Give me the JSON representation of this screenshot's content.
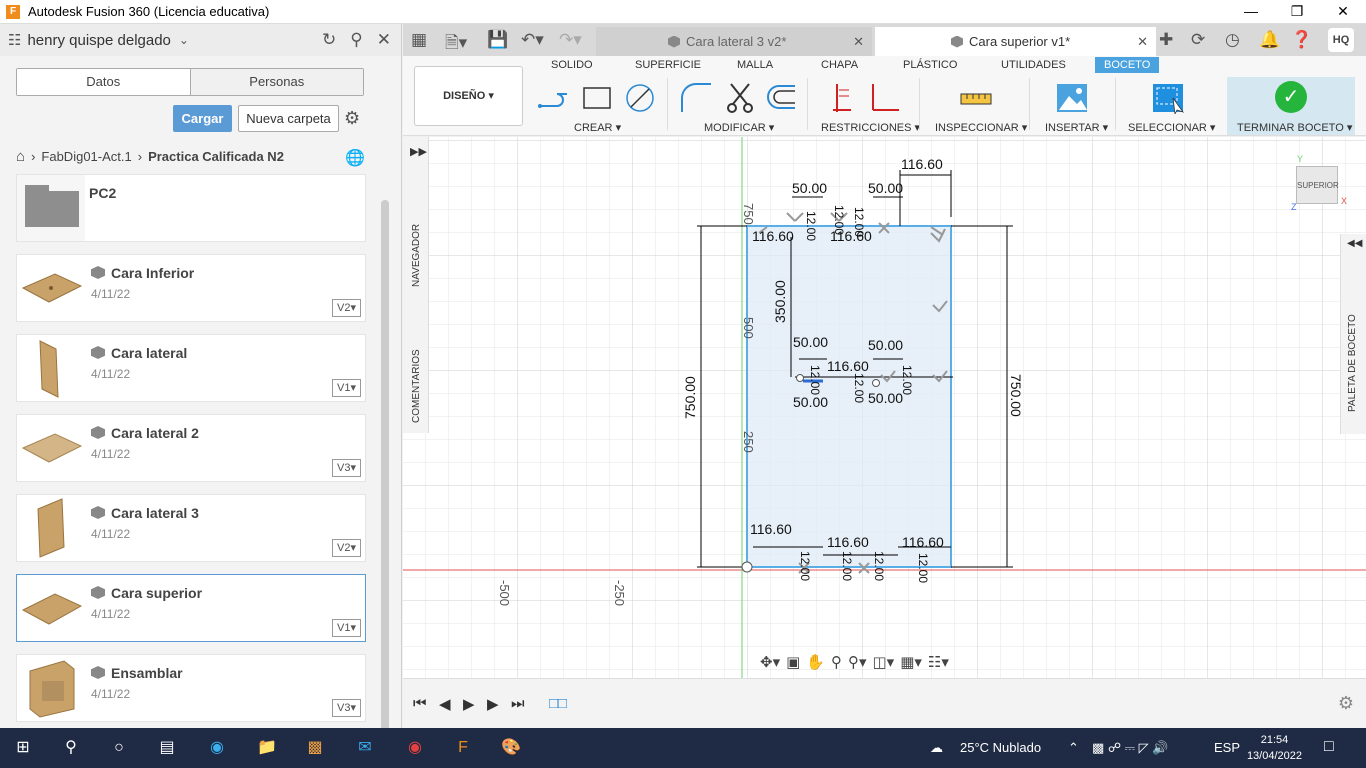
{
  "window": {
    "title": "Autodesk Fusion 360 (Licencia educativa)",
    "logo_letter": "F"
  },
  "data_panel": {
    "user": "henry quispe delgado",
    "tabs": [
      "Datos",
      "Personas"
    ],
    "upload_label": "Cargar",
    "new_folder_label": "Nueva carpeta",
    "breadcrumb": [
      "FabDig01-Act.1",
      "Practica Calificada N2"
    ],
    "folder": {
      "name": "PC2"
    },
    "files": [
      {
        "name": "Cara Inferior",
        "date": "4/11/22",
        "version": "V2"
      },
      {
        "name": "Cara lateral",
        "date": "4/11/22",
        "version": "V1"
      },
      {
        "name": "Cara lateral 2",
        "date": "4/11/22",
        "version": "V3"
      },
      {
        "name": "Cara lateral 3",
        "date": "4/11/22",
        "version": "V2"
      },
      {
        "name": "Cara superior",
        "date": "4/11/22",
        "version": "V1"
      },
      {
        "name": "Ensamblar",
        "date": "4/11/22",
        "version": "V3"
      }
    ]
  },
  "doc_tabs": [
    {
      "label": "Cara lateral 3 v2*"
    },
    {
      "label": "Cara superior v1*"
    }
  ],
  "profile_initials": "HQ",
  "toolbar": {
    "workspace": "DISEÑO",
    "menus": [
      "SOLIDO",
      "SUPERFICIE",
      "MALLA",
      "CHAPA",
      "PLÁSTICO",
      "UTILIDADES",
      "BOCETO"
    ],
    "groups": {
      "create": "CREAR",
      "modify": "MODIFICAR",
      "constraints": "RESTRICCIONES",
      "inspect": "INSPECCIONAR",
      "insert": "INSERTAR",
      "select": "SELECCIONAR",
      "finish": "TERMINAR BOCETO"
    }
  },
  "canvas": {
    "navigator_label": "NAVEGADOR",
    "comments_label": "COMENTARIOS",
    "palette_label": "PALETA DE BOCETO",
    "viewcube_label": "SUPERIOR",
    "axis_labels": {
      "y": "Y",
      "x": "X",
      "z": "Z"
    },
    "ruler_labels": [
      "-500",
      "-250",
      "750",
      "500",
      "250"
    ],
    "dimensions": {
      "top_right": "116.60",
      "top_a": "50.00",
      "top_b": "50.00",
      "top_c": "116.60",
      "top_d": "116.60",
      "top_v1": "12.00",
      "top_v2": "12.00",
      "top_v3": "12.00",
      "mid_v": "350.00",
      "mid_a": "50.00",
      "mid_b": "50.00",
      "mid_c": "116.60",
      "mid_d": "50.00",
      "mid_e": "50.00",
      "mid_v1": "12.00",
      "mid_v2": "12.00",
      "mid_v3": "12.00",
      "left_height": "750.00",
      "right_height": "750.00",
      "bot_a": "116.60",
      "bot_b": "116.60",
      "bot_c": "116.60",
      "bot_v1": "12.00",
      "bot_v2": "12.00",
      "bot_v3": "12.00",
      "bot_v4": "12.00"
    }
  },
  "taskbar": {
    "weather": "25°C  Nublado",
    "lang": "ESP",
    "time": "21:54",
    "date": "13/04/2022"
  },
  "colors": {
    "accent": "#5b9bd5",
    "finish_green": "#25b43c",
    "sketch_blue": "#4aa3df"
  }
}
